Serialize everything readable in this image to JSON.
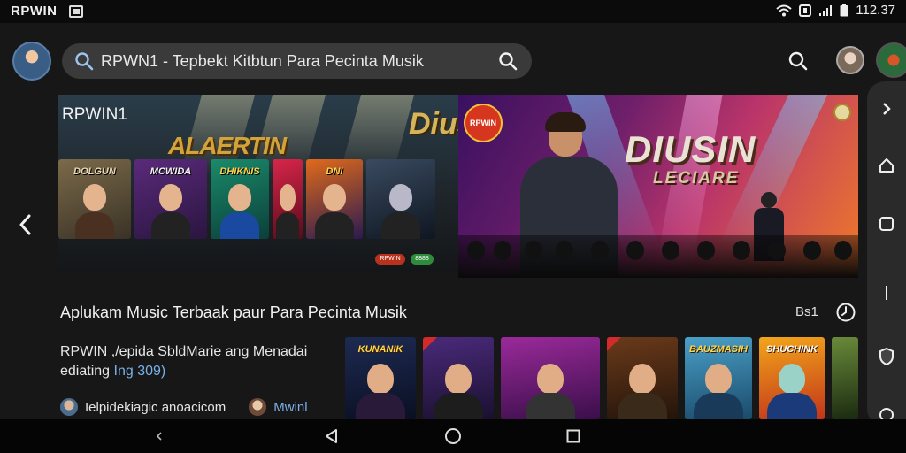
{
  "status_bar": {
    "app_name": "RPWIN",
    "time": "112.37"
  },
  "header": {
    "search_text": "RPWN1 - Tepbekt Kitbtun Para Pecinta Musik"
  },
  "hero": {
    "left_title": "RPWIN1",
    "left_word": "ALAERTIN",
    "left_word2": "Diusi",
    "thumb_captions": [
      "DOLGUN",
      "MCWIDA",
      "DHIKNIS",
      "",
      "DNI",
      ""
    ],
    "pill_red": "RPWIN",
    "pill_green": "8888",
    "right_logo": "RPWIN",
    "right_title": "DIUSIN",
    "right_subtitle": "LECIARE"
  },
  "section": {
    "title": "Aplukam Music Terbaak paur Para Pecinta Musik",
    "meta": "Bs1",
    "desc_line1": "RPWIN ,/epida SbldMarie ang Menadai",
    "desc_line2_prefix": "ediating ",
    "desc_line2_accent": "Ing 309)",
    "developer": "Ielpidekiagic anoacicom",
    "developer2": "Mwinl",
    "card_captions": [
      "KUNANIK",
      "",
      "",
      "",
      "BAUZMASIH",
      "SHUCHINK",
      ""
    ]
  },
  "colors": {
    "background": "#171717",
    "search_bg": "#3a3a3a",
    "accent_link": "#7ab0e8"
  },
  "icons": [
    "search-icon",
    "chevron-left-icon",
    "history-icon",
    "home-icon",
    "back-icon",
    "recents-icon"
  ]
}
